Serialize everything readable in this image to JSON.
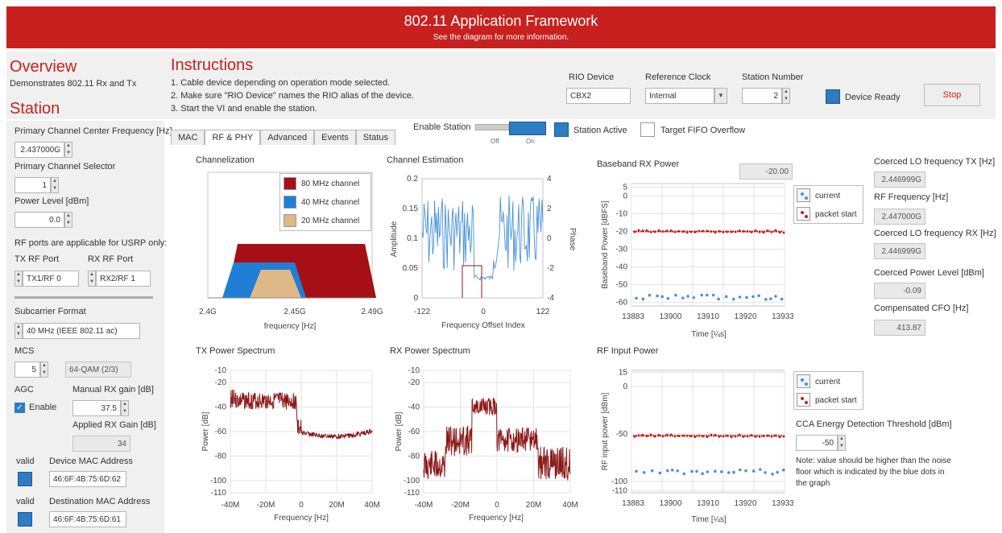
{
  "header": {
    "title": "802.11 Application Framework",
    "subtitle": "See the diagram for more information."
  },
  "overview": {
    "title": "Overview",
    "desc": "Demonstrates 802.11 Rx and Tx",
    "station": "Station"
  },
  "instructions": {
    "title": "Instructions",
    "steps": [
      "1. Cable device depending on operation mode selected.",
      "2. Make sure \"RIO Device\" names the RIO alias of the device.",
      "3. Start the VI and enable the station."
    ]
  },
  "top_controls": {
    "rio_label": "RIO Device",
    "rio_value": "CBX2",
    "ref_label": "Reference Clock",
    "ref_value": "Internal",
    "station_num_label": "Station Number",
    "station_num_value": "2",
    "device_ready": "Device Ready",
    "stop": "Stop"
  },
  "station_bar": {
    "enable_station": "Enable Station",
    "off": "Off",
    "on": "On",
    "station_active": "Station Active",
    "target_fifo": "Target FIFO Overflow"
  },
  "left": {
    "primary_freq_label": "Primary Channel Center Frequency [Hz]",
    "primary_freq_value": "2.437000G",
    "primary_sel_label": "Primary Channel Selector",
    "primary_sel_value": "1",
    "power_label": "Power Level [dBm]",
    "power_value": "0.0",
    "rf_note": "RF ports are applicable for USRP only:",
    "tx_port_label": "TX RF Port",
    "tx_port_value": "TX1/RF 0",
    "rx_port_label": "RX RF Port",
    "rx_port_value": "RX2/RF 1",
    "subcarrier_label": "Subcarrier Format",
    "subcarrier_value": "40 MHz (IEEE 802.11 ac)",
    "mcs_label": "MCS",
    "mcs_value": "5",
    "mcs_desc": "64-QAM (2/3)",
    "agc_label": "AGC",
    "agc_enable": "Enable",
    "manual_gain_label": "Manual RX gain [dB]",
    "manual_gain_value": "37.5",
    "applied_gain_label": "Applied RX Gain [dB]",
    "applied_gain_value": "34",
    "valid1": "valid",
    "device_mac_label": "Device MAC Address",
    "device_mac_value": "46:6F:4B:75:6D:62",
    "valid2": "valid",
    "dest_mac_label": "Destination MAC Address",
    "dest_mac_value": "46:6F:4B:75:6D:61"
  },
  "tabs": [
    "MAC",
    "RF & PHY",
    "Advanced",
    "Events",
    "Status"
  ],
  "panels": {
    "channelization": "Channelization",
    "chan_estimation": "Channel Estimation",
    "baseband": "Baseband RX Power",
    "baseband_value": "-20.00",
    "tx_spectrum": "TX Power Spectrum",
    "rx_spectrum": "RX Power Spectrum",
    "rf_input": "RF Input Power"
  },
  "right": {
    "lo_tx_label": "Coerced LO frequency TX [Hz]",
    "lo_tx_value": "2.446999G",
    "rf_freq_label": "RF Frequency [Hz]",
    "rf_freq_value": "2.447000G",
    "lo_rx_label": "Coerced LO frequency RX [Hz]",
    "lo_rx_value": "2.446999G",
    "cpl_label": "Coerced Power Level [dBm]",
    "cpl_value": "-0.09",
    "cfo_label": "Compensated CFO [Hz]",
    "cfo_value": "413.87",
    "cca_label": "CCA Energy Detection Threshold [dBm]",
    "cca_value": "-50",
    "note": "Note: value should be higher than the noise floor which is indicated by the blue dots in the graph"
  },
  "colors": {
    "header": "#c8201f",
    "accent": "#2e7cc2",
    "trace": "#8b1a1a"
  },
  "chart_data": [
    {
      "type": "area",
      "id": "channelization",
      "xlabel": "frequency [Hz]",
      "x_ticks": [
        "2.4G",
        "2.45G",
        "2.49G"
      ],
      "legend": [
        "80 MHz channel",
        "40 MHz channel",
        "20 MHz channel"
      ],
      "legend_colors": [
        "#a50f15",
        "#1f7fd4",
        "#deb887"
      ]
    },
    {
      "type": "line",
      "id": "chan_estimation",
      "xlabel": "Frequency Offset Index",
      "ylabel": "Amplitude",
      "y2label": "Phase",
      "x_ticks": [
        "-122",
        "0",
        "122"
      ],
      "y_ticks": [
        "0.2",
        "0.15",
        "0.1",
        "0.05",
        "0"
      ],
      "y2_ticks": [
        "4",
        "2",
        "0",
        "-2",
        "-4"
      ]
    },
    {
      "type": "scatter",
      "id": "baseband",
      "xlabel": "Time [¼s]",
      "ylabel": "Baseband Power [dBFS]",
      "x_ticks": [
        "13883",
        "13900",
        "13910",
        "13920",
        "13933"
      ],
      "y_ticks": [
        "5",
        "0",
        "-10",
        "-20",
        "-30",
        "-40",
        "-50",
        "-60"
      ],
      "series": [
        {
          "name": "current",
          "level": -57
        },
        {
          "name": "packet start",
          "level": -20
        }
      ]
    },
    {
      "type": "line",
      "id": "tx_spectrum",
      "xlabel": "Frequency [Hz]",
      "ylabel": "Power [dB]",
      "x_ticks": [
        "-40M",
        "-20M",
        "0",
        "20M",
        "40M"
      ],
      "y_ticks": [
        "-10",
        "-20",
        "-40",
        "-60",
        "-80",
        "-100",
        "-110"
      ]
    },
    {
      "type": "line",
      "id": "rx_spectrum",
      "xlabel": "Frequency [Hz]",
      "ylabel": "Power [dB]",
      "x_ticks": [
        "-40M",
        "-20M",
        "0",
        "20M",
        "40M"
      ],
      "y_ticks": [
        "-10",
        "-20",
        "-40",
        "-60",
        "-80",
        "-100",
        "-110"
      ]
    },
    {
      "type": "scatter",
      "id": "rf_input",
      "xlabel": "Time [¼s]",
      "ylabel": "RF input power [dBm]",
      "x_ticks": [
        "13883",
        "13900",
        "13910",
        "13920",
        "13933"
      ],
      "y_ticks": [
        "15",
        "0",
        "-50",
        "-100",
        "-110"
      ],
      "series": [
        {
          "name": "current",
          "level": -90
        },
        {
          "name": "packet start",
          "level": -52
        }
      ]
    }
  ]
}
